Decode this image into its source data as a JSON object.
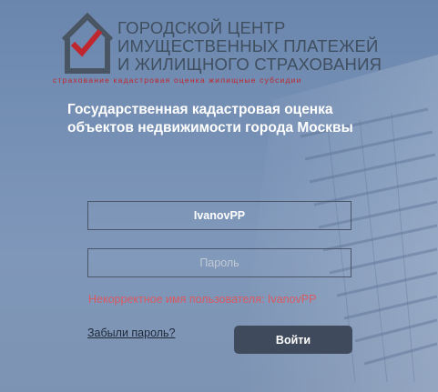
{
  "logo": {
    "lines": [
      "ГОРОДСКОЙ ЦЕНТР",
      "ИМУЩЕСТВЕННЫХ ПЛАТЕЖЕЙ",
      "И ЖИЛИЩНОГО СТРАХОВАНИЯ"
    ],
    "tagline": "страхование   кадастровая оценка   жилищные субсидии"
  },
  "title": {
    "line1": "Государственная кадастровая оценка",
    "line2": "объектов недвижимости города Москвы"
  },
  "form": {
    "username_value": "IvanovPP",
    "password_placeholder": "Пароль",
    "error_text": "Некорректное имя пользователя: IvanovPP",
    "forgot_label": "Забыли пароль?",
    "submit_label": "Войти"
  },
  "colors": {
    "background": "#7690b5",
    "error": "#d95a63",
    "button": "#3f4b5c",
    "brand_red": "#c0262e",
    "brand_gray": "#4a5563"
  },
  "icons": [
    "house-checkmark-logo-icon"
  ]
}
